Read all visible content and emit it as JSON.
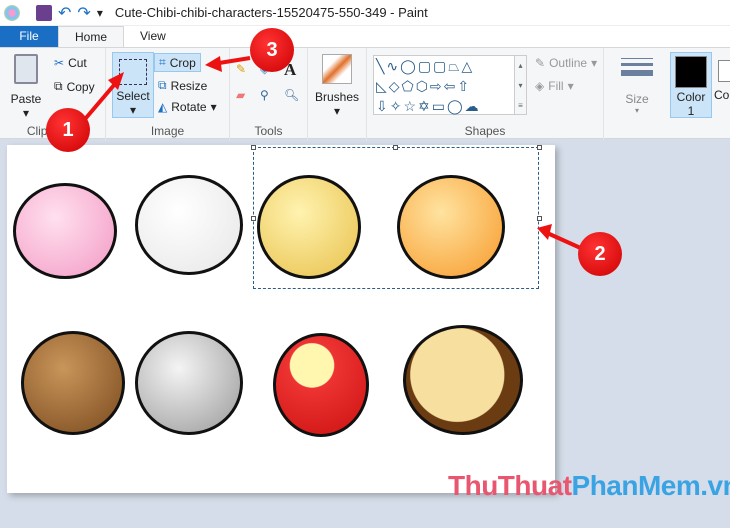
{
  "window": {
    "title": "Cute-Chibi-chibi-characters-15520475-550-349 - Paint"
  },
  "tabs": [
    {
      "label": "File"
    },
    {
      "label": "Home"
    },
    {
      "label": "View"
    }
  ],
  "clipboard": {
    "paste": "Paste",
    "cut": "Cut",
    "copy": "Copy",
    "label": "Clipboard"
  },
  "image": {
    "select": "Select",
    "crop": "Crop",
    "resize": "Resize",
    "rotate": "Rotate",
    "label": "Image"
  },
  "tools": {
    "label": "Tools"
  },
  "brushes": {
    "label": "Brushes"
  },
  "shapes": {
    "label": "Shapes",
    "outline": "Outline",
    "fill": "Fill"
  },
  "size": {
    "label": "Size"
  },
  "colors": {
    "color1": "Color",
    "color1_num": "1",
    "color2": "Color",
    "color1_value": "#000000"
  },
  "markers": [
    "1",
    "2",
    "3"
  ],
  "watermark": {
    "part1": "ThuThuat",
    "part2": "PhanMem.vn",
    "color1": "#e8576f",
    "color2": "#3aa3e3"
  },
  "characters": [
    "pig",
    "seal",
    "cat",
    "fox",
    "bear",
    "mouse",
    "ladybug",
    "lion"
  ]
}
